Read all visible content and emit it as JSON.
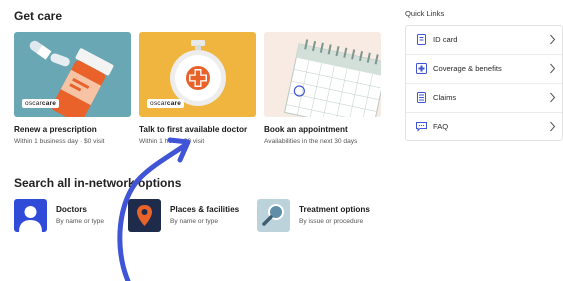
{
  "get_care": {
    "title": "Get care",
    "cards": [
      {
        "title": "Renew a prescription",
        "subtitle": "Within 1 business day · $0 visit",
        "brand_prefix": "oscar",
        "brand_suffix": "care"
      },
      {
        "title": "Talk to first available doctor",
        "subtitle": "Within 1 hour · $0 visit",
        "brand_prefix": "oscar",
        "brand_suffix": "care"
      },
      {
        "title": "Book an appointment",
        "subtitle": "Availabilities in the next 30 days"
      }
    ]
  },
  "search": {
    "title": "Search all in-network options",
    "options": [
      {
        "title": "Doctors",
        "subtitle": "By name or type",
        "icon": "person-icon"
      },
      {
        "title": "Places & facilities",
        "subtitle": "By name or type",
        "icon": "location-pin-icon"
      },
      {
        "title": "Treatment options",
        "subtitle": "By issue or procedure",
        "icon": "magnifier-icon"
      }
    ]
  },
  "quick_links": {
    "title": "Quick Links",
    "items": [
      {
        "label": "ID card",
        "icon": "id-card-icon"
      },
      {
        "label": "Coverage & benefits",
        "icon": "coverage-icon"
      },
      {
        "label": "Claims",
        "icon": "claims-icon"
      },
      {
        "label": "FAQ",
        "icon": "faq-chat-icon"
      }
    ]
  },
  "colors": {
    "card1_bg": "#6aa7b4",
    "card2_bg": "#f0b53f",
    "card3_bg": "#f7ebe3",
    "accent_blue": "#4055d6",
    "pill_orange": "#e8622a",
    "doctor_icon_bg": "#2f4bd8",
    "places_icon_bg": "#1e2b4a",
    "treatment_icon_bg": "#bcd3dc"
  },
  "cursor_mark": "arrow-annotation"
}
